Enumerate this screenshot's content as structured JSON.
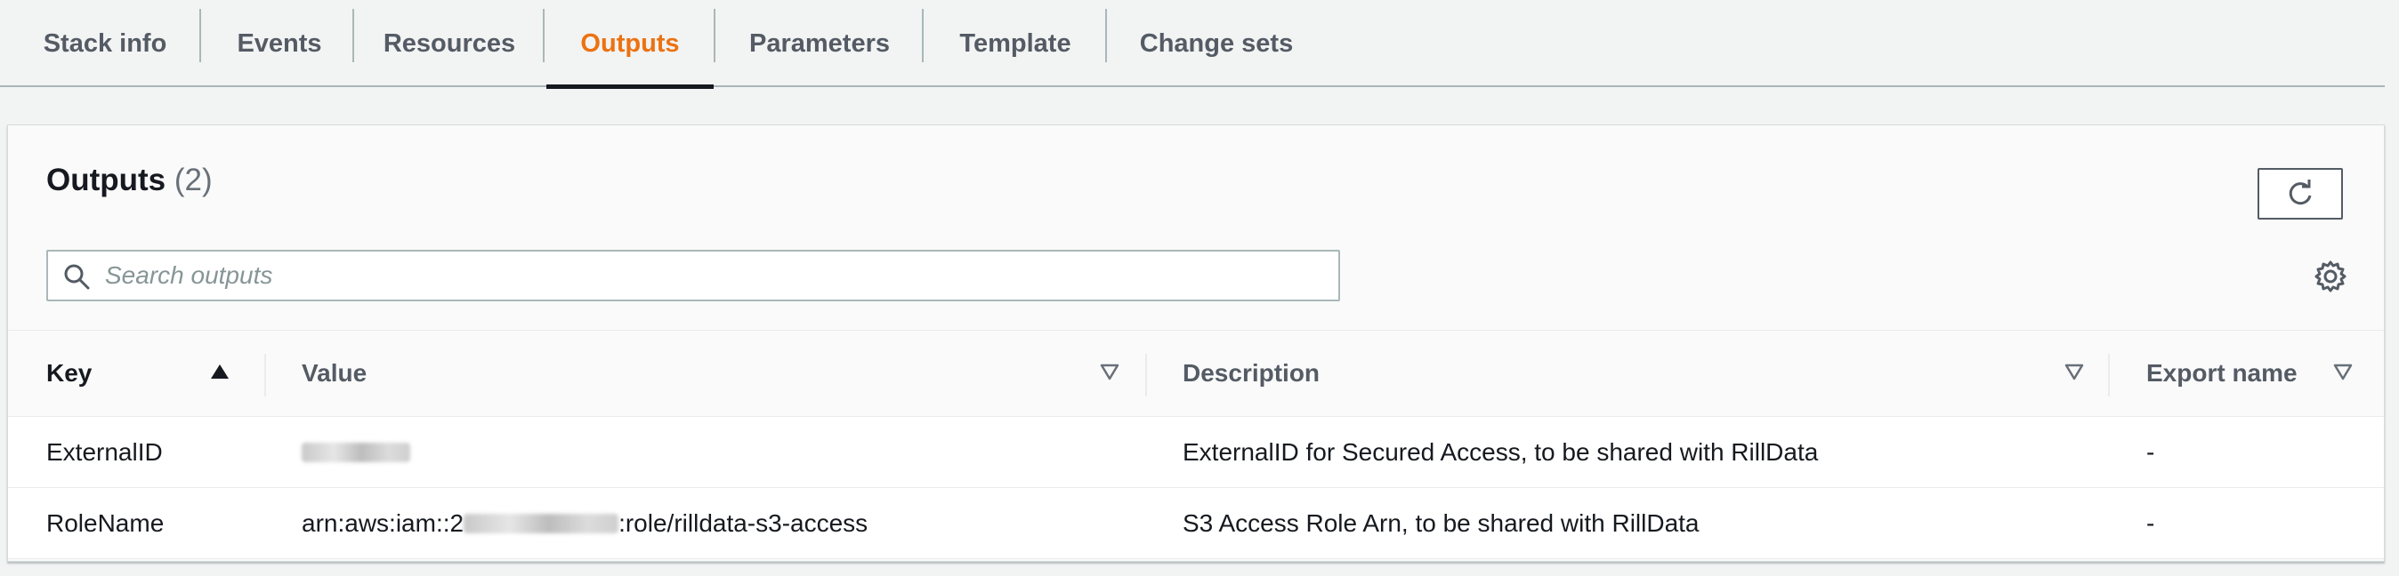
{
  "tabs": [
    {
      "label": "Stack info",
      "active": false
    },
    {
      "label": "Events",
      "active": false
    },
    {
      "label": "Resources",
      "active": false
    },
    {
      "label": "Outputs",
      "active": true
    },
    {
      "label": "Parameters",
      "active": false
    },
    {
      "label": "Template",
      "active": false
    },
    {
      "label": "Change sets",
      "active": false
    }
  ],
  "panel": {
    "title": "Outputs",
    "count": "(2)"
  },
  "search": {
    "placeholder": "Search outputs",
    "value": ""
  },
  "table": {
    "columns": [
      {
        "label": "Key",
        "sort": "ascending"
      },
      {
        "label": "Value",
        "sort": "none"
      },
      {
        "label": "Description",
        "sort": "none"
      },
      {
        "label": "Export name",
        "sort": "none"
      }
    ],
    "rows": [
      {
        "key": "ExternalID",
        "value_redacted": true,
        "description": "ExternalID for Secured Access, to be shared with RillData",
        "export_name": "-"
      },
      {
        "key": "RoleName",
        "value_prefix": "arn:aws:iam::2",
        "value_suffix": ":role/rilldata-s3-access",
        "description": "S3 Access Role Arn, to be shared with RillData",
        "export_name": "-"
      }
    ]
  },
  "icons": {
    "search": "search-icon",
    "refresh": "refresh-icon",
    "settings": "gear-icon",
    "sort_asc": "sort-ascending-icon",
    "sort_none": "sort-unsorted-icon"
  },
  "colors": {
    "active_tab": "#ec7211",
    "text": "#16191f",
    "muted": "#545b64",
    "background": "#f2f3f3"
  }
}
